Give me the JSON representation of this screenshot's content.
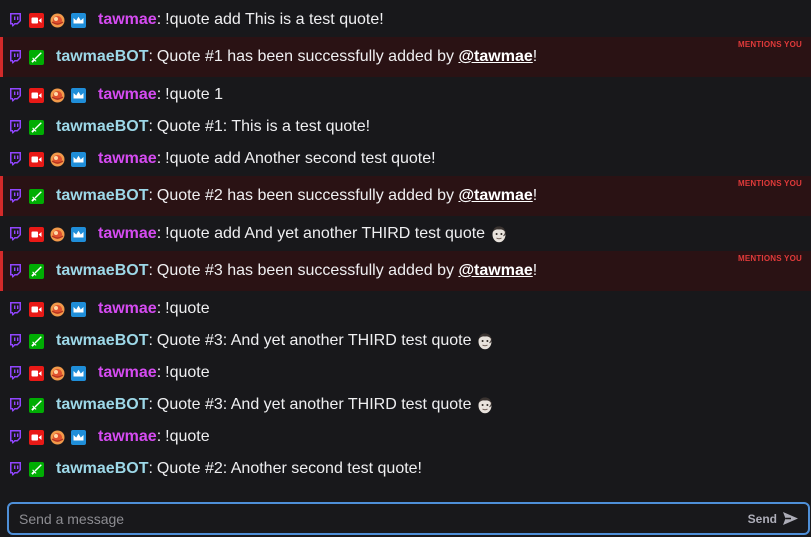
{
  "colors": {
    "tawmae_name": "#d54bf1",
    "bot_name": "#9dd8e8",
    "mention_bg": "#2a1214",
    "mention_bar": "#d42a2a",
    "input_border": "#4e8fd8"
  },
  "messages": [
    {
      "user": "tawmae",
      "badges": [
        "twitch-icon",
        "broadcaster-icon",
        "mana-orb-icon",
        "crown-icon"
      ],
      "parts": [
        "!quote add This is a test quote!"
      ]
    },
    {
      "user": "tawmaeBOT",
      "badges": [
        "twitch-icon",
        "moderator-sword-icon"
      ],
      "mention": true,
      "mention_label": "MENTIONS YOU",
      "parts": [
        "Quote #1 has been successfully added by ",
        "@tawmae",
        "!"
      ]
    },
    {
      "user": "tawmae",
      "badges": [
        "twitch-icon",
        "broadcaster-icon",
        "mana-orb-icon",
        "crown-icon"
      ],
      "parts": [
        "!quote 1"
      ]
    },
    {
      "user": "tawmaeBOT",
      "badges": [
        "twitch-icon",
        "moderator-sword-icon"
      ],
      "parts": [
        "Quote #1: This is a test quote!"
      ]
    },
    {
      "user": "tawmae",
      "badges": [
        "twitch-icon",
        "broadcaster-icon",
        "mana-orb-icon",
        "crown-icon"
      ],
      "parts": [
        "!quote add Another second test quote!"
      ]
    },
    {
      "user": "tawmaeBOT",
      "badges": [
        "twitch-icon",
        "moderator-sword-icon"
      ],
      "mention": true,
      "mention_label": "MENTIONS YOU",
      "parts": [
        "Quote #2 has been successfully added by ",
        "@tawmae",
        "!"
      ]
    },
    {
      "user": "tawmae",
      "badges": [
        "twitch-icon",
        "broadcaster-icon",
        "mana-orb-icon",
        "crown-icon"
      ],
      "parts": [
        "!quote add And yet another THIRD test quote"
      ],
      "emote": "face-emote-icon"
    },
    {
      "user": "tawmaeBOT",
      "badges": [
        "twitch-icon",
        "moderator-sword-icon"
      ],
      "mention": true,
      "mention_label": "MENTIONS YOU",
      "parts": [
        "Quote #3 has been successfully added by ",
        "@tawmae",
        "!"
      ]
    },
    {
      "user": "tawmae",
      "badges": [
        "twitch-icon",
        "broadcaster-icon",
        "mana-orb-icon",
        "crown-icon"
      ],
      "parts": [
        "!quote"
      ]
    },
    {
      "user": "tawmaeBOT",
      "badges": [
        "twitch-icon",
        "moderator-sword-icon"
      ],
      "parts": [
        "Quote #3: And yet another THIRD test quote"
      ],
      "emote": "face-emote-icon"
    },
    {
      "user": "tawmae",
      "badges": [
        "twitch-icon",
        "broadcaster-icon",
        "mana-orb-icon",
        "crown-icon"
      ],
      "parts": [
        "!quote"
      ]
    },
    {
      "user": "tawmaeBOT",
      "badges": [
        "twitch-icon",
        "moderator-sword-icon"
      ],
      "parts": [
        "Quote #3: And yet another THIRD test quote"
      ],
      "emote": "face-emote-icon"
    },
    {
      "user": "tawmae",
      "badges": [
        "twitch-icon",
        "broadcaster-icon",
        "mana-orb-icon",
        "crown-icon"
      ],
      "parts": [
        "!quote"
      ]
    },
    {
      "user": "tawmaeBOT",
      "badges": [
        "twitch-icon",
        "moderator-sword-icon"
      ],
      "parts": [
        "Quote #2: Another second test quote!"
      ]
    }
  ],
  "composer": {
    "placeholder": "Send a message",
    "value": "",
    "send_label": "Send"
  }
}
